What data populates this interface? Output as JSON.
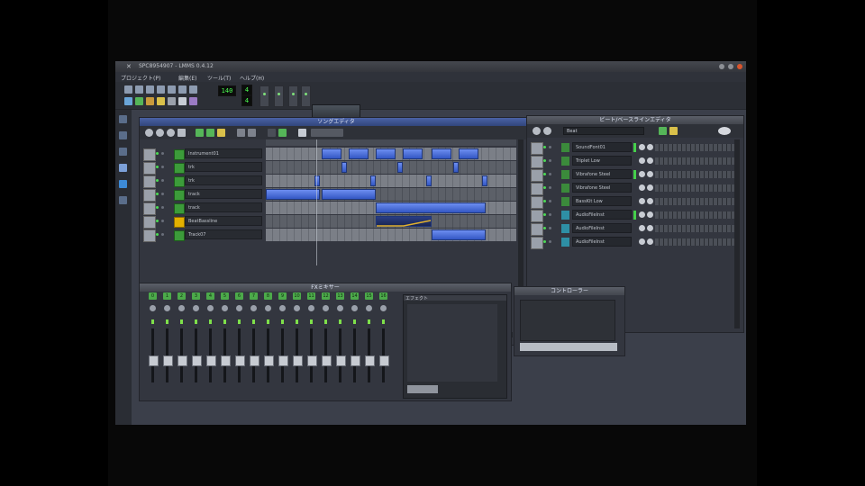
{
  "window": {
    "title": "SPC8954907 - LMMS 0.4.12"
  },
  "menu": [
    {
      "label": "プロジェクト(P)"
    },
    {
      "label": "編集(E)"
    },
    {
      "label": "ツール(T)"
    },
    {
      "label": "ヘルプ(H)"
    }
  ],
  "toolbar": {
    "tempo": "140",
    "timesig_top": "4",
    "timesig_bottom": "4"
  },
  "song_editor": {
    "title": "ソングエディタ",
    "tracks": [
      {
        "name": "Instrument01",
        "type": "instrument"
      },
      {
        "name": "trk",
        "type": "instrument"
      },
      {
        "name": "trk",
        "type": "instrument"
      },
      {
        "name": "track",
        "type": "instrument"
      },
      {
        "name": "track",
        "type": "instrument"
      },
      {
        "name": "BeatBassline",
        "type": "beat"
      },
      {
        "name": "Track07",
        "type": "instrument"
      }
    ]
  },
  "fx_editor": {
    "title": "ビート/ベースラインエディタ",
    "preset": "Beat",
    "rows": [
      {
        "name": "SoundFont01",
        "icon": "green"
      },
      {
        "name": "Triplet Low",
        "icon": "green"
      },
      {
        "name": "Vibrafone Steel",
        "icon": "green"
      },
      {
        "name": "Vibrafone Steel",
        "icon": "green"
      },
      {
        "name": "BassKit Low",
        "icon": "green"
      },
      {
        "name": "AudioFileInst",
        "icon": "cyan"
      },
      {
        "name": "AudioFileInst",
        "icon": "cyan"
      },
      {
        "name": "AudioFileInst",
        "icon": "cyan"
      }
    ]
  },
  "mixer": {
    "title": "FXミキサー",
    "channels": [
      "0",
      "1",
      "2",
      "3",
      "4",
      "5",
      "6",
      "7",
      "8",
      "9",
      "10",
      "11",
      "12",
      "13",
      "14",
      "15",
      "16"
    ],
    "effects_title": "エフェクト",
    "add_effect_label": ""
  },
  "controller": {
    "title": "コントローラー"
  },
  "colors": {
    "clip": "#4d72e0",
    "accent": "#3c5fb5",
    "led": "#4cff52"
  }
}
